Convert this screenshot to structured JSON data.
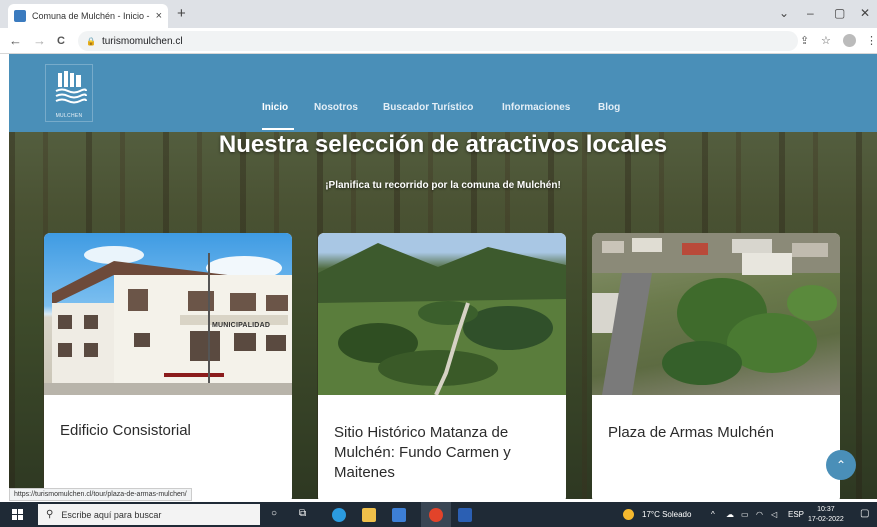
{
  "browser": {
    "tab_title": "Comuna de Mulchén - Inicio - Tu",
    "tab_close": "×",
    "new_tab": "+",
    "window_controls": [
      "⌄",
      "–",
      "▢",
      "✕"
    ],
    "url": "turismomulchen.cl",
    "nav": {
      "back": "←",
      "forward": "→",
      "reload": "C"
    },
    "right_icons": [
      "share-icon",
      "star-icon",
      "profile-icon",
      "menu-icon"
    ]
  },
  "site": {
    "brand_color": "#4a8fb8",
    "logo_text": "MULCHEN",
    "nav": [
      {
        "label": "Inicio",
        "active": true
      },
      {
        "label": "Nosotros"
      },
      {
        "label": "Buscador Turístico"
      },
      {
        "label": "Informaciones"
      },
      {
        "label": "Blog"
      }
    ],
    "hero": {
      "title": "Nuestra selección de atractivos locales",
      "subtitle": "¡Planifica tu recorrido por la comuna de Mulchén!"
    },
    "cards": [
      {
        "title": "Edificio Consistorial",
        "image_label": "MUNICIPALIDAD"
      },
      {
        "title": "Sitio Histórico Matanza de Mulchén: Fundo Carmen y Maitenes"
      },
      {
        "title": "Plaza de Armas Mulchén"
      }
    ],
    "scroll_up": "⌃"
  },
  "status_link": "https://turismomulchen.cl/tour/plaza-de-armas-mulchen/",
  "taskbar": {
    "search_placeholder": "Escribe aquí para buscar",
    "weather": "17°C  Soleado",
    "language": "ESP",
    "time": "10:37",
    "date": "17-02-2022"
  }
}
